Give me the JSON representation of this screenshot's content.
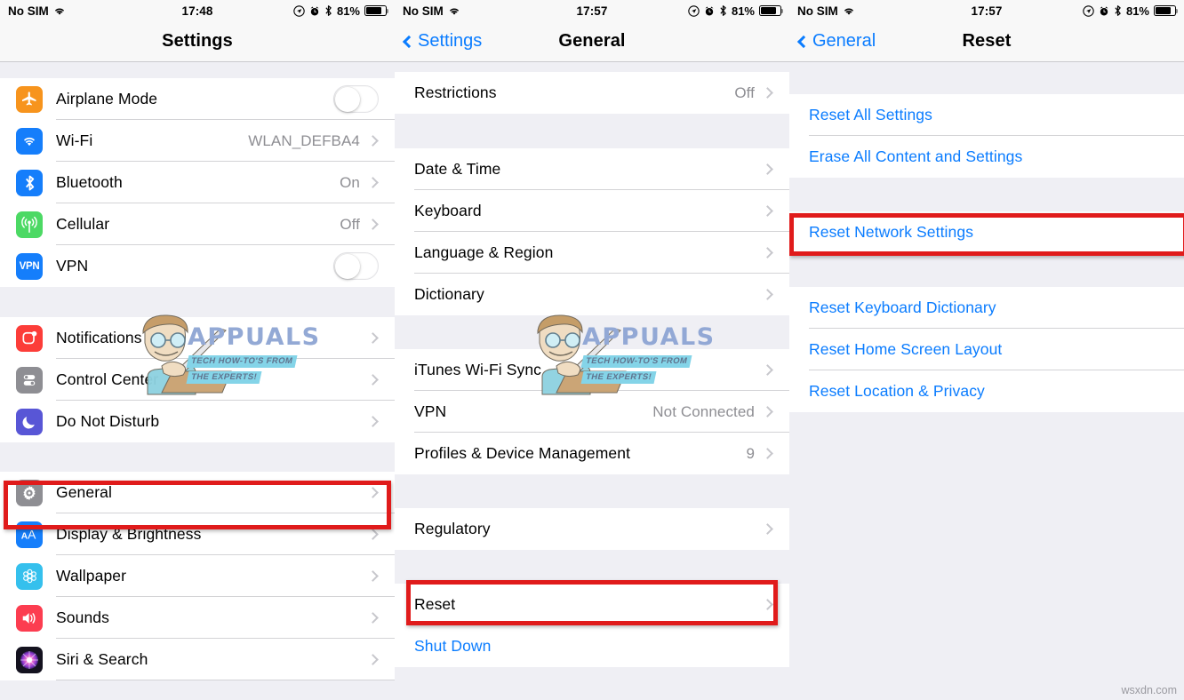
{
  "watermark": {
    "brand": "APPUALS",
    "tagline_line1": "TECH HOW-TO'S FROM",
    "tagline_line2": "THE EXPERTS!",
    "site": "wsxdn.com"
  },
  "colors": {
    "highlight": "#e01b1b",
    "accent_blue": "#0a7cff",
    "list_bg": "#efeff4",
    "row_bg": "#ffffff",
    "value_gray": "#8e8e93"
  },
  "panels": [
    {
      "status": {
        "carrier": "No SIM",
        "wifi_icon": "wifi-icon",
        "time": "17:48",
        "location_icon": "location-arrow-icon",
        "alarm_icon": "alarm-clock-icon",
        "bluetooth_icon": "bluetooth-icon",
        "battery_percent": "81%",
        "battery_icon": "battery-icon"
      },
      "nav": {
        "back_label": null,
        "title": "Settings"
      },
      "groups": [
        {
          "rows": [
            {
              "icon": "airplane-icon",
              "icon_color": "#f7941d",
              "label": "Airplane Mode",
              "control": "toggle",
              "toggle_on": false
            },
            {
              "icon": "wifi-icon",
              "icon_color": "#157efb",
              "label": "Wi-Fi",
              "value": "WLAN_DEFBA4",
              "control": "chevron"
            },
            {
              "icon": "bluetooth-icon",
              "icon_color": "#157efb",
              "label": "Bluetooth",
              "value": "On",
              "control": "chevron"
            },
            {
              "icon": "cellular-icon",
              "icon_color": "#4cd964",
              "label": "Cellular",
              "value": "Off",
              "control": "chevron"
            },
            {
              "icon": "vpn-icon",
              "icon_color": "#157efb",
              "label": "VPN",
              "control": "toggle",
              "toggle_on": false
            }
          ]
        },
        {
          "rows": [
            {
              "icon": "notifications-icon",
              "icon_color": "#fc3d39",
              "label": "Notifications",
              "control": "chevron"
            },
            {
              "icon": "control-center-icon",
              "icon_color": "#8e8e93",
              "label": "Control Center",
              "control": "chevron"
            },
            {
              "icon": "do-not-disturb-icon",
              "icon_color": "#5856d6",
              "label": "Do Not Disturb",
              "control": "chevron"
            }
          ]
        },
        {
          "rows": [
            {
              "icon": "gear-icon",
              "icon_color": "#8e8e93",
              "label": "General",
              "control": "chevron",
              "highlighted": true
            },
            {
              "icon": "display-brightness-icon",
              "icon_color": "#157efb",
              "label": "Display & Brightness",
              "control": "chevron"
            },
            {
              "icon": "wallpaper-icon",
              "icon_color": "#35c0ed",
              "label": "Wallpaper",
              "control": "chevron"
            },
            {
              "icon": "sounds-icon",
              "icon_color": "#fc3d50",
              "label": "Sounds",
              "control": "chevron"
            },
            {
              "icon": "siri-search-icon",
              "icon_color": "#1a1a2e",
              "label": "Siri & Search",
              "control": "chevron"
            }
          ]
        }
      ]
    },
    {
      "status": {
        "carrier": "No SIM",
        "wifi_icon": "wifi-icon",
        "time": "17:57",
        "location_icon": "location-arrow-icon",
        "alarm_icon": "alarm-clock-icon",
        "bluetooth_icon": "bluetooth-icon",
        "battery_percent": "81%",
        "battery_icon": "battery-icon"
      },
      "nav": {
        "back_label": "Settings",
        "title": "General"
      },
      "groups": [
        {
          "rows": [
            {
              "label": "Restrictions",
              "value": "Off",
              "control": "chevron"
            }
          ]
        },
        {
          "rows": [
            {
              "label": "Date & Time",
              "control": "chevron"
            },
            {
              "label": "Keyboard",
              "control": "chevron"
            },
            {
              "label": "Language & Region",
              "control": "chevron"
            },
            {
              "label": "Dictionary",
              "control": "chevron"
            }
          ]
        },
        {
          "rows": [
            {
              "label": "iTunes Wi-Fi Sync",
              "control": "chevron"
            },
            {
              "label": "VPN",
              "value": "Not Connected",
              "control": "chevron"
            },
            {
              "label": "Profiles & Device Management",
              "value": "9",
              "control": "chevron"
            }
          ]
        },
        {
          "rows": [
            {
              "label": "Regulatory",
              "control": "chevron"
            }
          ]
        },
        {
          "rows": [
            {
              "label": "Reset",
              "control": "chevron",
              "highlighted": true
            },
            {
              "label": "Shut Down",
              "control": "none",
              "blue": true
            }
          ]
        }
      ]
    },
    {
      "status": {
        "carrier": "No SIM",
        "wifi_icon": "wifi-icon",
        "time": "17:57",
        "location_icon": "location-arrow-icon",
        "alarm_icon": "alarm-clock-icon",
        "bluetooth_icon": "bluetooth-icon",
        "battery_percent": "81%",
        "battery_icon": "battery-icon"
      },
      "nav": {
        "back_label": "General",
        "title": "Reset"
      },
      "groups": [
        {
          "rows": [
            {
              "label": "Reset All Settings",
              "control": "none",
              "blue": true
            },
            {
              "label": "Erase All Content and Settings",
              "control": "none",
              "blue": true
            }
          ]
        },
        {
          "rows": [
            {
              "label": "Reset Network Settings",
              "control": "none",
              "blue": true,
              "highlighted": true
            }
          ]
        },
        {
          "rows": [
            {
              "label": "Reset Keyboard Dictionary",
              "control": "none",
              "blue": true
            },
            {
              "label": "Reset Home Screen Layout",
              "control": "none",
              "blue": true
            },
            {
              "label": "Reset Location & Privacy",
              "control": "none",
              "blue": true
            }
          ]
        }
      ]
    }
  ]
}
